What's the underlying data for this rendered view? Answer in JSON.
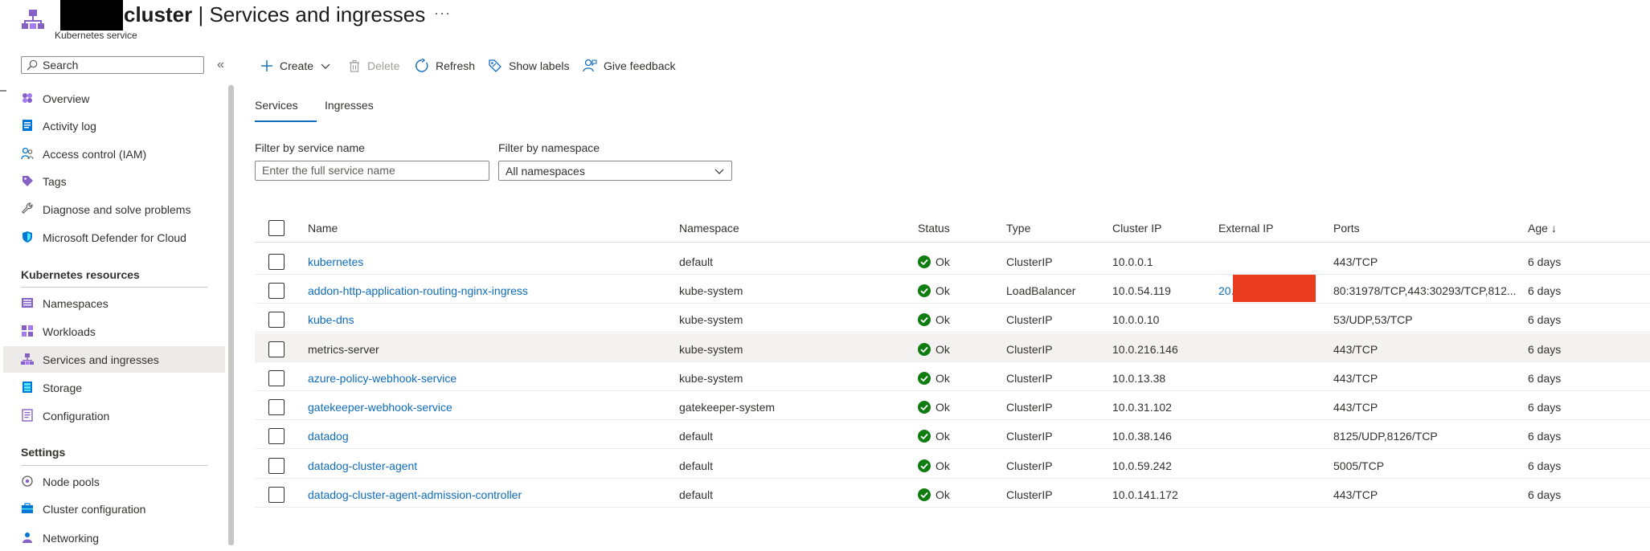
{
  "header": {
    "title_bold": "cluster",
    "title_rest": " | Services and ingresses",
    "subtitle": "Kubernetes service",
    "more": "···"
  },
  "search": {
    "placeholder": "Search"
  },
  "collapse_glyph": "«",
  "sidebar": {
    "items_top": [
      {
        "label": "Overview",
        "icon": "overview-icon"
      },
      {
        "label": "Activity log",
        "icon": "activity-log-icon"
      },
      {
        "label": "Access control (IAM)",
        "icon": "people-icon"
      },
      {
        "label": "Tags",
        "icon": "tag-icon"
      },
      {
        "label": "Diagnose and solve problems",
        "icon": "wrench-icon"
      },
      {
        "label": "Microsoft Defender for Cloud",
        "icon": "shield-icon"
      }
    ],
    "section_k8s": "Kubernetes resources",
    "items_k8s": [
      {
        "label": "Namespaces",
        "icon": "namespaces-icon"
      },
      {
        "label": "Workloads",
        "icon": "workloads-icon"
      },
      {
        "label": "Services and ingresses",
        "icon": "services-icon",
        "active": true
      },
      {
        "label": "Storage",
        "icon": "storage-icon"
      },
      {
        "label": "Configuration",
        "icon": "configuration-icon"
      }
    ],
    "section_settings": "Settings",
    "items_settings": [
      {
        "label": "Node pools",
        "icon": "node-pools-icon"
      },
      {
        "label": "Cluster configuration",
        "icon": "cluster-config-icon"
      },
      {
        "label": "Networking",
        "icon": "networking-icon"
      }
    ]
  },
  "toolbar": {
    "create": "Create",
    "delete": "Delete",
    "refresh": "Refresh",
    "show_labels": "Show labels",
    "feedback": "Give feedback"
  },
  "tabs": {
    "services": "Services",
    "ingresses": "Ingresses",
    "active": "services"
  },
  "filters": {
    "service_label": "Filter by service name",
    "service_placeholder": "Enter the full service name",
    "namespace_label": "Filter by namespace",
    "namespace_value": "All namespaces"
  },
  "table": {
    "columns": {
      "name": "Name",
      "namespace": "Namespace",
      "status": "Status",
      "type": "Type",
      "cluster_ip": "Cluster IP",
      "external_ip": "External IP",
      "ports": "Ports",
      "age": "Age"
    },
    "age_sort_glyph": "↓",
    "rows": [
      {
        "name": "kubernetes",
        "namespace": "default",
        "status": "Ok",
        "type": "ClusterIP",
        "cluster_ip": "10.0.0.1",
        "external_ip": "",
        "ports": "443/TCP",
        "age": "6 days"
      },
      {
        "name": "addon-http-application-routing-nginx-ingress",
        "namespace": "kube-system",
        "status": "Ok",
        "type": "LoadBalancer",
        "cluster_ip": "10.0.54.119",
        "external_ip": "20.",
        "ports": "80:31978/TCP,443:30293/TCP,812...",
        "age": "6 days"
      },
      {
        "name": "kube-dns",
        "namespace": "kube-system",
        "status": "Ok",
        "type": "ClusterIP",
        "cluster_ip": "10.0.0.10",
        "external_ip": "",
        "ports": "53/UDP,53/TCP",
        "age": "6 days"
      },
      {
        "name": "metrics-server",
        "namespace": "kube-system",
        "status": "Ok",
        "type": "ClusterIP",
        "cluster_ip": "10.0.216.146",
        "external_ip": "",
        "ports": "443/TCP",
        "age": "6 days"
      },
      {
        "name": "azure-policy-webhook-service",
        "namespace": "kube-system",
        "status": "Ok",
        "type": "ClusterIP",
        "cluster_ip": "10.0.13.38",
        "external_ip": "",
        "ports": "443/TCP",
        "age": "6 days"
      },
      {
        "name": "gatekeeper-webhook-service",
        "namespace": "gatekeeper-system",
        "status": "Ok",
        "type": "ClusterIP",
        "cluster_ip": "10.0.31.102",
        "external_ip": "",
        "ports": "443/TCP",
        "age": "6 days"
      },
      {
        "name": "datadog",
        "namespace": "default",
        "status": "Ok",
        "type": "ClusterIP",
        "cluster_ip": "10.0.38.146",
        "external_ip": "",
        "ports": "8125/UDP,8126/TCP",
        "age": "6 days"
      },
      {
        "name": "datadog-cluster-agent",
        "namespace": "default",
        "status": "Ok",
        "type": "ClusterIP",
        "cluster_ip": "10.0.59.242",
        "external_ip": "",
        "ports": "5005/TCP",
        "age": "6 days"
      },
      {
        "name": "datadog-cluster-agent-admission-controller",
        "namespace": "default",
        "status": "Ok",
        "type": "ClusterIP",
        "cluster_ip": "10.0.141.172",
        "external_ip": "",
        "ports": "443/TCP",
        "age": "6 days"
      }
    ]
  },
  "colors": {
    "accent": "#0f6cbd",
    "ok": "#107c10",
    "redact": "#ea3c1f",
    "purple": "#8661c5"
  }
}
